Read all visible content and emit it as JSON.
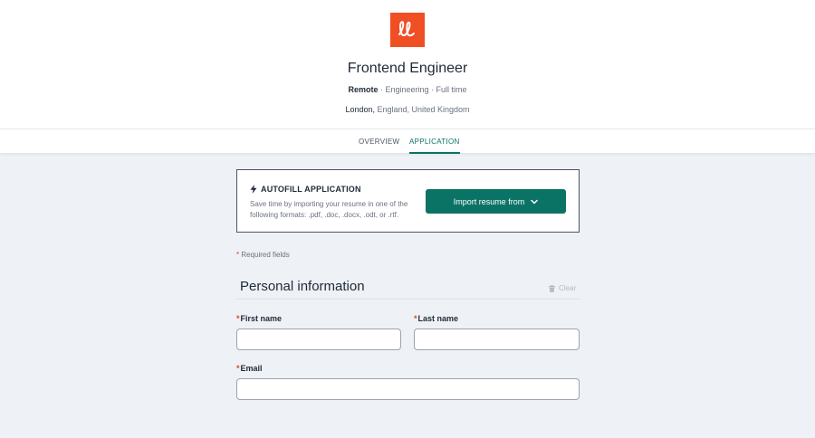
{
  "header": {
    "logo_icon": "lever-ll-logo",
    "logo_color": "#f04e23",
    "job_title": "Frontend Engineer",
    "work_type": "Remote",
    "meta_rest": " · Engineering · Full time",
    "city": "London,",
    "location_rest": " England, United Kingdom"
  },
  "tabs": [
    {
      "label": "OVERVIEW",
      "active": false
    },
    {
      "label": "APPLICATION",
      "active": true
    }
  ],
  "autofill": {
    "title": "AUTOFILL APPLICATION",
    "icon": "lightning-bolt-icon",
    "description": "Save time by importing your resume in one of the following formats: .pdf, .doc, .docx, .odt, or .rtf.",
    "button_label": "Import resume from",
    "button_icon": "chevron-down-icon"
  },
  "form": {
    "required_star": "*",
    "required_note": " Required fields",
    "section_title": "Personal information",
    "clear_label": "Clear",
    "clear_icon": "trash-icon",
    "first_name_label": "First name",
    "first_name_value": "",
    "last_name_label": "Last name",
    "last_name_value": "",
    "email_label": "Email",
    "email_value": ""
  },
  "colors": {
    "accent": "#0b7366",
    "brand": "#f04e23",
    "required": "#d9452f",
    "background": "#eef1f5"
  }
}
